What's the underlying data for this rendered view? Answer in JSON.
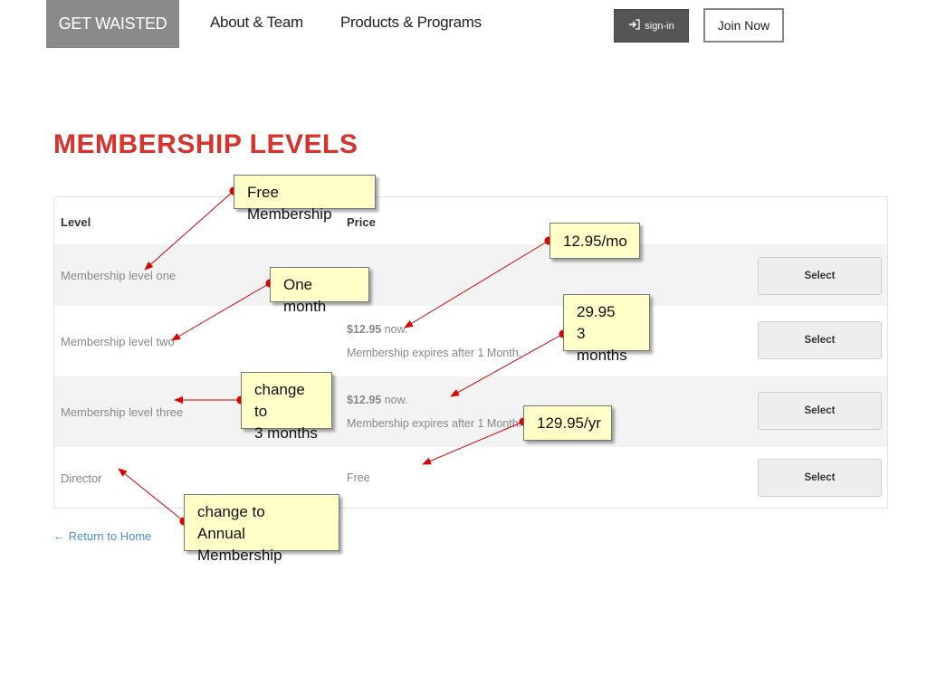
{
  "nav": {
    "brand": "GET WAISTED",
    "about": "About & Team",
    "products": "Products & Programs",
    "signin": "sign-in",
    "signin_icon": "sign-in-icon",
    "join": "Join Now"
  },
  "page": {
    "title": "MEMBERSHIP LEVELS",
    "return_link": "← Return to Home"
  },
  "table": {
    "headers": {
      "level": "Level",
      "price": "Price"
    },
    "select_label": "Select",
    "rows": [
      {
        "level": "Membership level one",
        "amount": "",
        "amount_suffix": "",
        "price_note": ""
      },
      {
        "level": "Membership level two",
        "amount": "$12.95",
        "amount_suffix": " now.",
        "price_note": "Membership expires after 1 Month."
      },
      {
        "level": "Membership level three",
        "amount": "$12.95",
        "amount_suffix": " now.",
        "price_note": "Membership expires after 1 Month."
      },
      {
        "level": "Director",
        "amount": "",
        "amount_suffix": "",
        "price_note": "Free"
      }
    ]
  },
  "annotations": {
    "free_membership": "Free Membership",
    "price_12": "12.95/mo",
    "one_month": "One month",
    "price_29_line1": "29.95",
    "price_29_line2": "3 months",
    "change_3_line1": "change to",
    "change_3_line2": "3 months",
    "price_129": "129.95/yr",
    "change_annual_line1": "change to",
    "change_annual_line2": "Annual Membership"
  },
  "colors": {
    "brand_bg": "#8a8a8a",
    "title": "#d8322c",
    "annotation_fill": "#ffffc8",
    "annotation_arrow": "#e00000",
    "link": "#4b8fd1"
  }
}
